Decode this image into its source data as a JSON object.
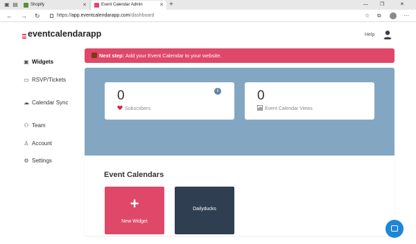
{
  "browser": {
    "tabs": [
      {
        "label": "Shopify",
        "favicon_color": "#5e8e3e"
      },
      {
        "label": "Event Calendar Admin",
        "favicon_color": "#e0476b"
      }
    ],
    "new_tab_symbol": "+",
    "url": {
      "scheme": "https://",
      "host": "app.eventcalendarapp.com",
      "path": "/dashboard"
    },
    "nav": {
      "back": "←",
      "forward": "→",
      "reload": "↻"
    },
    "window_controls": {
      "minimize": "—",
      "maximize": "❐",
      "close": "✕"
    }
  },
  "app": {
    "logo": {
      "brand": "eventcalendarapp",
      "accent_color": "#e0476b"
    },
    "help_label": "Help",
    "sidebar": {
      "items": [
        {
          "label": "Widgets",
          "icon": "calendar-icon",
          "glyph": "▣",
          "active": true
        },
        {
          "label": "RSVP/Tickets",
          "icon": "ticket-icon",
          "glyph": "▭",
          "active": false
        },
        {
          "label": "Calendar Sync",
          "icon": "cloud-icon",
          "glyph": "☁",
          "active": false
        },
        {
          "label": "Team",
          "icon": "team-icon",
          "glyph": "⚇",
          "active": false
        },
        {
          "label": "Account",
          "icon": "user-icon",
          "glyph": "♙",
          "active": false
        },
        {
          "label": "Settings",
          "icon": "gear-icon",
          "glyph": "⚙",
          "active": false
        }
      ]
    },
    "banner": {
      "strong": "Next step:",
      "text": " Add your Event Calendar to your website.",
      "color": "#df4869"
    },
    "stats": [
      {
        "value": "0",
        "label": "Subscribers",
        "icon": "heart-icon"
      },
      {
        "value": "0",
        "label": "Event Calendar Views",
        "icon": "chart-icon"
      }
    ],
    "stats_panel_color": "#83a7c3",
    "calendars": {
      "title": "Event Calendars",
      "new_widget": {
        "symbol": "+",
        "label": "New Widget"
      },
      "items": [
        {
          "label": "Dailyducks"
        }
      ]
    },
    "chat_button_color": "#1f86d6"
  }
}
